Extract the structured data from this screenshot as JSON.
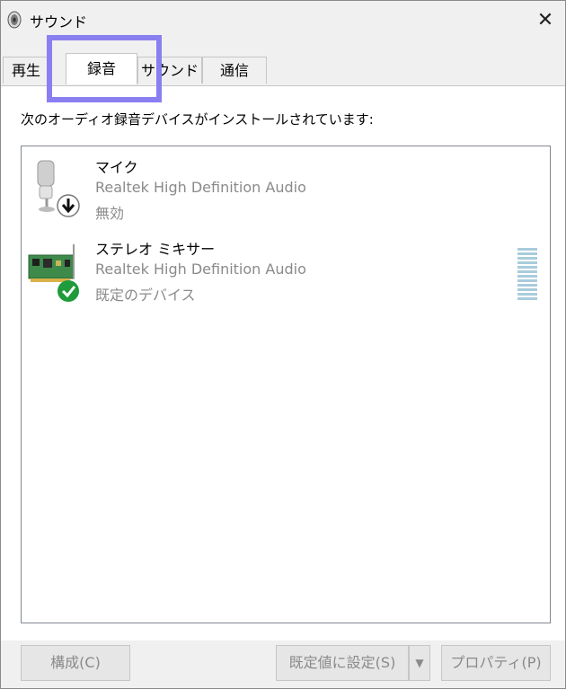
{
  "window": {
    "title": "サウンド"
  },
  "tabs": [
    {
      "label": "再生"
    },
    {
      "label": "録音",
      "selected": true
    },
    {
      "label": "サウンド"
    },
    {
      "label": "通信"
    }
  ],
  "instruction": "次のオーディオ録音デバイスがインストールされています:",
  "devices": [
    {
      "name": "マイク",
      "driver": "Realtek High Definition Audio",
      "status": "無効",
      "icon": "microphone-icon",
      "badge": "disabled-arrow-badge-icon"
    },
    {
      "name": "ステレオ ミキサー",
      "driver": "Realtek High Definition Audio",
      "status": "既定のデバイス",
      "icon": "sound-card-icon",
      "badge": "default-check-badge-icon"
    }
  ],
  "buttons": {
    "configure": "構成(C)",
    "set_default": "既定値に設定(S)",
    "properties": "プロパティ(P)"
  },
  "colors": {
    "highlight": "#8a7ff0",
    "check_badge": "#1e9b3a",
    "level_meter": "#a9ccdd"
  }
}
